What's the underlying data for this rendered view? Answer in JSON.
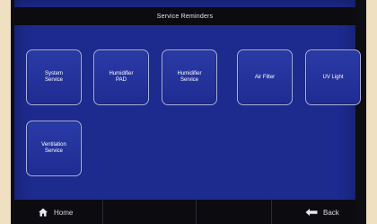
{
  "header": {
    "title": "Service Reminders"
  },
  "tiles": [
    {
      "label": "System\nService"
    },
    {
      "label": "Humidifier\nPAD"
    },
    {
      "label": "Humidifier\nService"
    },
    {
      "label": "Air Filter"
    },
    {
      "label": "UV Light"
    },
    {
      "label": "Ventilation\nService"
    }
  ],
  "footer": {
    "home_label": "Home",
    "back_label": "Back"
  },
  "colors": {
    "screen": "#1d2a8e",
    "bars": "#0b0b10",
    "tile_border": "#a8b0dc"
  }
}
